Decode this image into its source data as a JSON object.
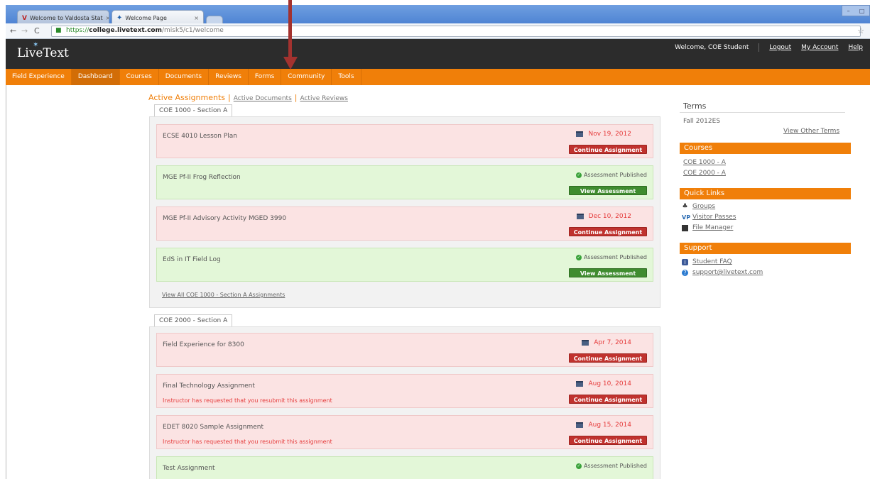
{
  "browser": {
    "tabs": [
      {
        "label": "Welcome to Valdosta Stat"
      },
      {
        "label": "Welcome Page"
      }
    ],
    "url_scheme": "https://",
    "url_domain": "college.livetext.com",
    "url_path": "/misk5/c1/welcome"
  },
  "header": {
    "logo": "LiveText",
    "welcome": "Welcome, COE Student",
    "logout": "Logout",
    "my_account": "My Account",
    "help": "Help"
  },
  "nav": {
    "items": [
      "Field Experience",
      "Dashboard",
      "Courses",
      "Documents",
      "Reviews",
      "Forms",
      "Community",
      "Tools"
    ],
    "active": "Dashboard"
  },
  "active_tabs": {
    "current": "Active Assignments",
    "documents": "Active Documents",
    "reviews": "Active Reviews"
  },
  "sections": [
    {
      "name": "COE 1000 - Section A",
      "view_all": "View All COE 1000 - Section A Assignments",
      "cards": [
        {
          "title": "ECSE 4010 Lesson Plan",
          "date": "Nov 19, 2012",
          "button": "Continue Assignment",
          "status": "pink"
        },
        {
          "title": "MGE Pf-II Frog Reflection",
          "published": "Assessment Published",
          "button": "View Assessment",
          "status": "green"
        },
        {
          "title": "MGE Pf-II Advisory Activity MGED 3990",
          "date": "Dec 10, 2012",
          "button": "Continue Assignment",
          "status": "pink"
        },
        {
          "title": "EdS in IT Field Log",
          "published": "Assessment Published",
          "button": "View Assessment",
          "status": "green"
        }
      ]
    },
    {
      "name": "COE 2000 - Section A",
      "cards": [
        {
          "title": "Field Experience for 8300",
          "date": "Apr 7, 2014",
          "button": "Continue Assignment",
          "status": "pink"
        },
        {
          "title": "Final Technology Assignment",
          "date": "Aug 10, 2014",
          "warning": "Instructor has requested that you resubmit this assignment",
          "button": "Continue Assignment",
          "status": "pink"
        },
        {
          "title": "EDET 8020 Sample Assignment",
          "date": "Aug 15, 2014",
          "warning": "Instructor has requested that you resubmit this assignment",
          "button": "Continue Assignment",
          "status": "pink"
        },
        {
          "title": "Test Assignment",
          "published": "Assessment Published",
          "status": "green"
        }
      ]
    }
  ],
  "sidebar": {
    "terms_title": "Terms",
    "term": "Fall 2012ES",
    "other_terms": "View Other Terms",
    "courses_title": "Courses",
    "courses": [
      "COE 1000 - A",
      "COE 2000 - A"
    ],
    "quick_links_title": "Quick Links",
    "quick_links": [
      "Groups",
      "Visitor Passes",
      "File Manager"
    ],
    "support_title": "Support",
    "support": [
      "Student FAQ",
      "support@livetext.com"
    ]
  },
  "colors": {
    "orange": "#f07f09",
    "dark_header": "#2c2c2c",
    "red_button": "#c0322e",
    "green_button": "#3f8c2f",
    "annotation_arrow": "#a3322f"
  }
}
